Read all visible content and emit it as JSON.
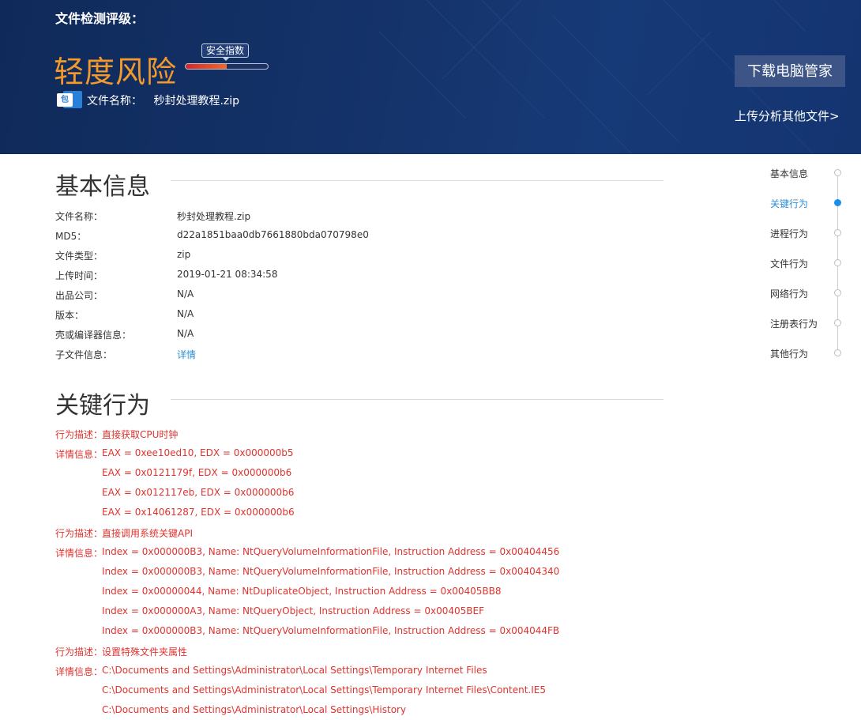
{
  "header": {
    "label": "文件检测评级：",
    "risk_level": "轻度风险",
    "safety_tag": "安全指数",
    "safety_level": 0.5,
    "file_icon_glyph": "包",
    "file_name_label": "文件名称：",
    "file_name": "秒封处理教程.zip",
    "download_button": "下载电脑管家",
    "upload_link": "上传分析其他文件>",
    "colors": {
      "risk": "#f39a2b",
      "banner": "#15336b",
      "safety_fill": "#d8262a"
    }
  },
  "basic_info": {
    "title": "基本信息",
    "rows": [
      {
        "key": "文件名称：",
        "value": "秒封处理教程.zip"
      },
      {
        "key": "MD5：",
        "value": "d22a1851baa0db7661880bda070798e0"
      },
      {
        "key": "文件类型：",
        "value": "zip"
      },
      {
        "key": "上传时间：",
        "value": "2019-01-21 08:34:58"
      },
      {
        "key": "出品公司：",
        "value": "N/A"
      },
      {
        "key": "版本：",
        "value": "N/A"
      },
      {
        "key": "壳或编译器信息：",
        "value": "N/A"
      },
      {
        "key": "子文件信息：",
        "value": "详情"
      }
    ]
  },
  "key_behaviors": {
    "title": "关键行为",
    "rows": [
      {
        "key": "行为描述：",
        "value": "直接获取CPU时钟"
      },
      {
        "key": "详情信息：",
        "value": "EAX = 0xee10ed10, EDX = 0x000000b5"
      },
      {
        "key": "",
        "value": "EAX = 0x0121179f, EDX = 0x000000b6"
      },
      {
        "key": "",
        "value": "EAX = 0x012117eb, EDX = 0x000000b6"
      },
      {
        "key": "",
        "value": "EAX = 0x14061287, EDX = 0x000000b6"
      },
      {
        "key": "行为描述：",
        "value": "直接调用系统关键API"
      },
      {
        "key": "详情信息：",
        "value": "Index = 0x000000B3, Name: NtQueryVolumeInformationFile, Instruction Address = 0x00404456"
      },
      {
        "key": "",
        "value": "Index = 0x000000B3, Name: NtQueryVolumeInformationFile, Instruction Address = 0x00404340"
      },
      {
        "key": "",
        "value": "Index = 0x00000044, Name: NtDuplicateObject, Instruction Address = 0x00405BB8"
      },
      {
        "key": "",
        "value": "Index = 0x000000A3, Name: NtQueryObject, Instruction Address = 0x00405BEF"
      },
      {
        "key": "",
        "value": "Index = 0x000000B3, Name: NtQueryVolumeInformationFile, Instruction Address = 0x004044FB"
      },
      {
        "key": "行为描述：",
        "value": "设置特殊文件夹属性"
      },
      {
        "key": "详情信息：",
        "value": "C:\\Documents and Settings\\Administrator\\Local Settings\\Temporary Internet Files"
      },
      {
        "key": "",
        "value": "C:\\Documents and Settings\\Administrator\\Local Settings\\Temporary Internet Files\\Content.IE5"
      },
      {
        "key": "",
        "value": "C:\\Documents and Settings\\Administrator\\Local Settings\\History"
      }
    ]
  },
  "nav": {
    "active_index": 1,
    "items": [
      "基本信息",
      "关键行为",
      "进程行为",
      "文件行为",
      "网络行为",
      "注册表行为",
      "其他行为"
    ]
  }
}
